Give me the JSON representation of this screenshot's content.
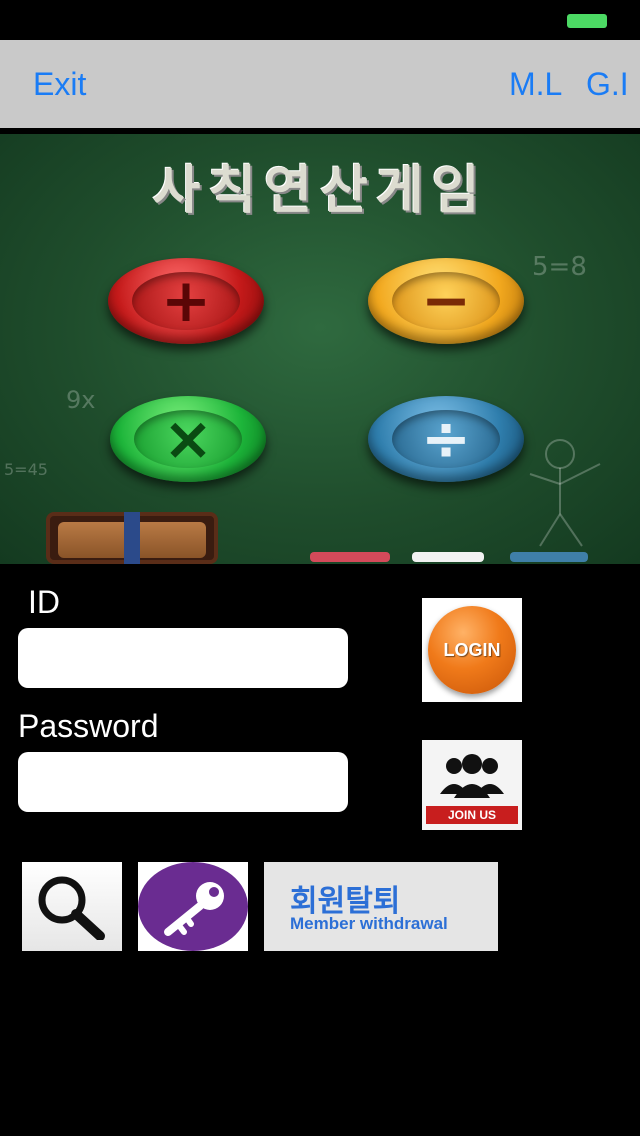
{
  "header": {
    "exit_label": "Exit",
    "ml_label": "M.L",
    "gi_label": "G.I"
  },
  "banner": {
    "title": "사칙연산게임",
    "operators": [
      "+",
      "−",
      "×",
      "÷"
    ],
    "chalk_marks": [
      "5=8",
      "9x",
      "5=45"
    ]
  },
  "login_form": {
    "id_label": "ID",
    "id_value": "",
    "password_label": "Password",
    "password_value": "",
    "login_button_label": "LOGIN",
    "join_button_label": "JOIN US"
  },
  "bottom_actions": {
    "withdraw_korean": "회원탈퇴",
    "withdraw_english": "Member withdrawal"
  },
  "colors": {
    "nav_accent": "#1a7cf5",
    "navbar_bg": "#c9c9c9",
    "battery": "#4cd964",
    "key_purple": "#6a2c91",
    "login_orange": "#f07a1a",
    "join_red": "#c81e1e",
    "withdraw_blue": "#2c6fd6"
  },
  "icons": {
    "search": "search-icon",
    "key": "key-icon",
    "people": "people-icon",
    "battery": "battery-icon"
  }
}
